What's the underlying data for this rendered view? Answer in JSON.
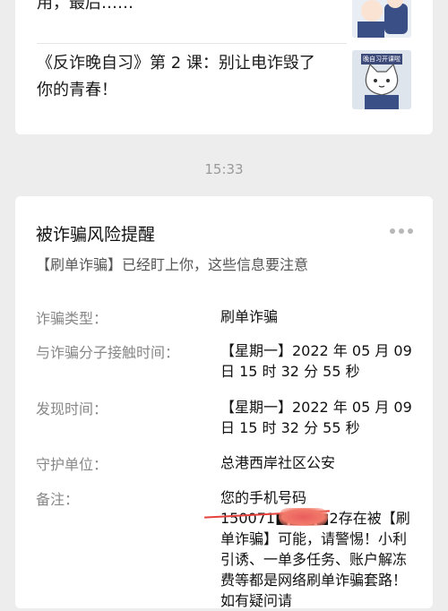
{
  "articles": [
    {
      "title": "用，最后……",
      "thumb_icon": "police-cartoon-icon"
    },
    {
      "title": "《反诈晚自习》第 2 课：别让电诈毁了你的青春！",
      "thumb_icon": "cat-police-icon",
      "thumb_text": "晚自习开课啦"
    }
  ],
  "timestamp": "15:33",
  "alert": {
    "title": "被诈骗风险提醒",
    "subtitle": "【刷单诈骗】已经盯上你，这些信息要注意",
    "fields": [
      {
        "label": "诈骗类型：",
        "value": "刷单诈骗"
      },
      {
        "label": "与诈骗分子接触时间：",
        "value": "【星期一】2022 年 05 月 09 日 15 时 32 分 55 秒"
      },
      {
        "label": "发现时间：",
        "value": "【星期一】2022 年 05 月 09 日 15 时 32 分 55 秒"
      },
      {
        "label": "守护单位：",
        "value": "总港西岸社区公安"
      },
      {
        "label": "备注：",
        "value": "您的手机号码 150071■■■■2存在被【刷单诈骗】可能，请警惕！小利引诱、一单多任务、账户解冻费等都是网络刷单诈骗套路！如有疑问请"
      }
    ]
  }
}
